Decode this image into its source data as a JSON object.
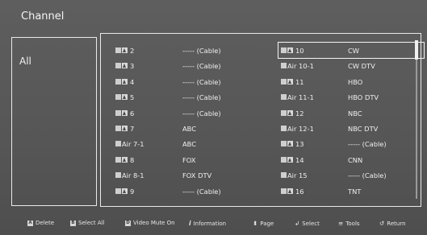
{
  "title": "Channel",
  "group": {
    "label": "All"
  },
  "columns": [
    {
      "rows": [
        {
          "num": "2",
          "name": "----- (Cable)",
          "type": "cable"
        },
        {
          "num": "3",
          "name": "----- (Cable)",
          "type": "cable"
        },
        {
          "num": "4",
          "name": "----- (Cable)",
          "type": "cable"
        },
        {
          "num": "5",
          "name": "----- (Cable)",
          "type": "cable"
        },
        {
          "num": "6",
          "name": "----- (Cable)",
          "type": "cable"
        },
        {
          "num": "7",
          "name": "ABC",
          "type": "cable"
        },
        {
          "num": "Air 7-1",
          "name": "ABC",
          "type": "air"
        },
        {
          "num": "8",
          "name": "FOX",
          "type": "cable"
        },
        {
          "num": "Air 8-1",
          "name": "FOX DTV",
          "type": "air"
        },
        {
          "num": "9",
          "name": "----- (Cable)",
          "type": "cable"
        }
      ]
    },
    {
      "rows": [
        {
          "num": "10",
          "name": "CW",
          "type": "cable",
          "selected": true
        },
        {
          "num": "Air 10-1",
          "name": "CW DTV",
          "type": "air"
        },
        {
          "num": "11",
          "name": "HBO",
          "type": "cable"
        },
        {
          "num": "Air 11-1",
          "name": "HBO DTV",
          "type": "air"
        },
        {
          "num": "12",
          "name": "NBC",
          "type": "cable"
        },
        {
          "num": "Air 12-1",
          "name": "NBC DTV",
          "type": "air"
        },
        {
          "num": "13",
          "name": "----- (Cable)",
          "type": "cable"
        },
        {
          "num": "14",
          "name": "CNN",
          "type": "cable"
        },
        {
          "num": "Air 15",
          "name": "----- (Cable)",
          "type": "air"
        },
        {
          "num": "16",
          "name": "TNT",
          "type": "cable"
        }
      ]
    }
  ],
  "footer": {
    "delete": {
      "key": "A",
      "label": "Delete"
    },
    "select_all": {
      "key": "B",
      "label": "Select All"
    },
    "video_mute": {
      "key": "D",
      "label": "Video Mute On"
    },
    "information": {
      "icon": "info-icon",
      "label": "Information"
    },
    "page": {
      "icon": "up-down-arrow-icon",
      "label": "Page"
    },
    "select": {
      "icon": "enter-icon",
      "label": "Select"
    },
    "tools": {
      "icon": "tools-icon",
      "label": "Tools"
    },
    "return": {
      "icon": "return-icon",
      "label": "Return"
    }
  }
}
